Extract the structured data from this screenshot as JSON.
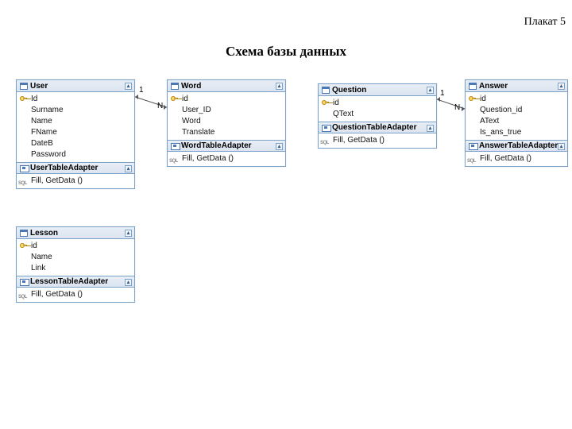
{
  "poster_label": "Плакат 5",
  "title": "Схема базы данных",
  "entities": {
    "user": {
      "name": "User",
      "fields": [
        "Id",
        "Surname",
        "Name",
        "FName",
        "DateB",
        "Password"
      ],
      "key_field": "Id",
      "adapter": "UserTableAdapter",
      "adapter_method": "Fill, GetData ()"
    },
    "word": {
      "name": "Word",
      "fields": [
        "id",
        "User_ID",
        "Word",
        "Translate"
      ],
      "key_field": "id",
      "adapter": "WordTableAdapter",
      "adapter_method": "Fill, GetData ()"
    },
    "question": {
      "name": "Question",
      "fields": [
        "id",
        "QText"
      ],
      "key_field": "id",
      "adapter": "QuestionTableAdapter",
      "adapter_method": "Fill, GetData ()"
    },
    "answer": {
      "name": "Answer",
      "fields": [
        "id",
        "Question_id",
        "AText",
        "Is_ans_true"
      ],
      "key_field": "id",
      "adapter": "AnswerTableAdapter",
      "adapter_method": "Fill, GetData ()"
    },
    "lesson": {
      "name": "Lesson",
      "fields": [
        "id",
        "Name",
        "Link"
      ],
      "key_field": "id",
      "adapter": "LessonTableAdapter",
      "adapter_method": "Fill, GetData ()"
    }
  },
  "relations": [
    {
      "from": "user",
      "to": "word",
      "from_card": "1",
      "to_card": "N"
    },
    {
      "from": "question",
      "to": "answer",
      "from_card": "1",
      "to_card": "N"
    }
  ]
}
